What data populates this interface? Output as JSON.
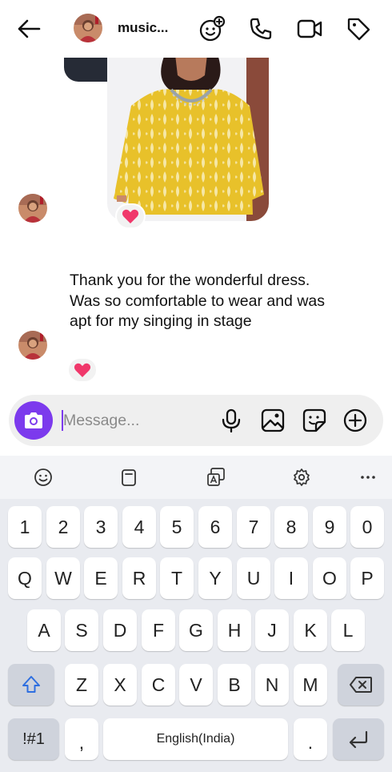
{
  "header": {
    "username": "music...",
    "icons": [
      "back-arrow-icon",
      "avatar",
      "effects-icon",
      "phone-icon",
      "video-camera-icon",
      "tag-icon"
    ]
  },
  "chat": {
    "message_text": "Thank you for the wonderful dress.  Was so comfortable to wear and was apt for my singing in stage",
    "reaction_emoji": "heart"
  },
  "composer": {
    "placeholder": "Message..."
  },
  "keyboard": {
    "toolbar": [
      "emoji-icon",
      "clipboard-icon",
      "translate-icon",
      "settings-icon",
      "more-icon"
    ],
    "number_row": [
      "1",
      "2",
      "3",
      "4",
      "5",
      "6",
      "7",
      "8",
      "9",
      "0"
    ],
    "row1": [
      "Q",
      "W",
      "E",
      "R",
      "T",
      "Y",
      "U",
      "I",
      "O",
      "P"
    ],
    "row2": [
      "A",
      "S",
      "D",
      "F",
      "G",
      "H",
      "J",
      "K",
      "L"
    ],
    "row3": [
      "Z",
      "X",
      "C",
      "V",
      "B",
      "N",
      "M"
    ],
    "symbols_key": "!#1",
    "comma_key": ",",
    "space_label": "English(India)",
    "period_key": "."
  },
  "colors": {
    "accent": "#7c3aed",
    "heart": "#f0386b",
    "keyboard_bg": "#e9ebf0",
    "dress_yellow": "#e9c32c"
  }
}
